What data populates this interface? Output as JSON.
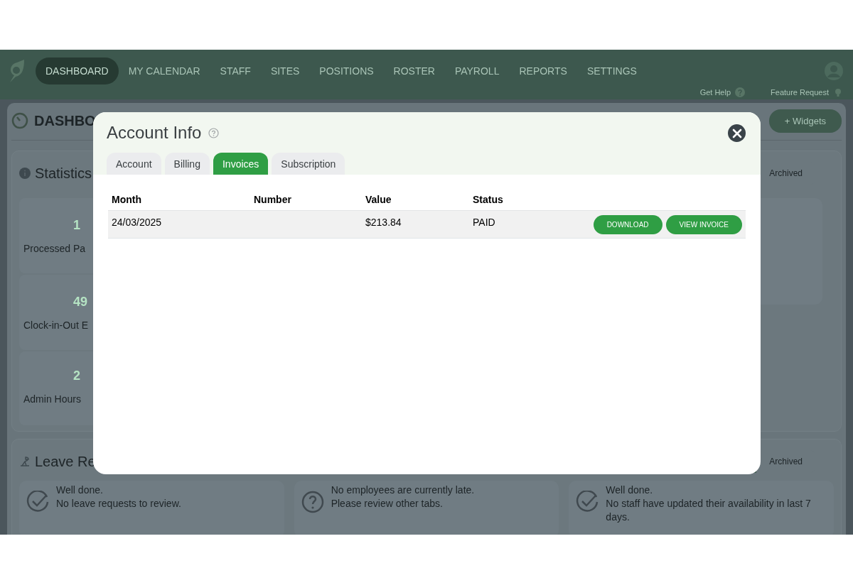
{
  "nav": {
    "items": [
      {
        "label": "DASHBOARD",
        "selected": true
      },
      {
        "label": "MY CALENDAR",
        "selected": false
      },
      {
        "label": "STAFF",
        "selected": false
      },
      {
        "label": "SITES",
        "selected": false
      },
      {
        "label": "POSITIONS",
        "selected": false
      },
      {
        "label": "ROSTER",
        "selected": false
      },
      {
        "label": "PAYROLL",
        "selected": false
      },
      {
        "label": "REPORTS",
        "selected": false
      },
      {
        "label": "SETTINGS",
        "selected": false
      }
    ],
    "links": [
      {
        "kind": "help",
        "label": "Get Help"
      },
      {
        "kind": "idea",
        "label": "Feature Request"
      }
    ]
  },
  "dashboard": {
    "title": "DASHBO",
    "widgets_button": "+ Widgets",
    "statistics": {
      "title": "Statistics",
      "filter_tab": "Archived",
      "stats": [
        {
          "value": "1",
          "label": "Processed Pa"
        },
        {
          "value": "49",
          "label": "Clock-in-Out E"
        },
        {
          "value": "2",
          "label": "Admin Hours"
        }
      ]
    },
    "leave": {
      "title": "Leave Re",
      "filter_tab": "Archived",
      "cards": [
        {
          "kind": "check",
          "lines": [
            "Well done.",
            "No leave requests to review."
          ]
        },
        {
          "kind": "question",
          "lines": [
            "No employees are currently late.",
            "Please review other tabs."
          ]
        },
        {
          "kind": "check",
          "lines": [
            "Well done.",
            "No staff have updated their availability in last 7 days."
          ]
        }
      ]
    }
  },
  "modal": {
    "title": "Account Info",
    "tabs": [
      {
        "label": "Account",
        "selected": false
      },
      {
        "label": "Billing",
        "selected": false
      },
      {
        "label": "Invoices",
        "selected": true
      },
      {
        "label": "Subscription",
        "selected": false
      }
    ],
    "table": {
      "columns": [
        "Month",
        "Number",
        "Value",
        "Status"
      ],
      "rows": [
        {
          "month": "24/03/2025",
          "value": "$213.84",
          "status": "PAID",
          "actions": [
            "DOWNLOAD",
            "VIEW INVOICE"
          ]
        }
      ]
    }
  }
}
